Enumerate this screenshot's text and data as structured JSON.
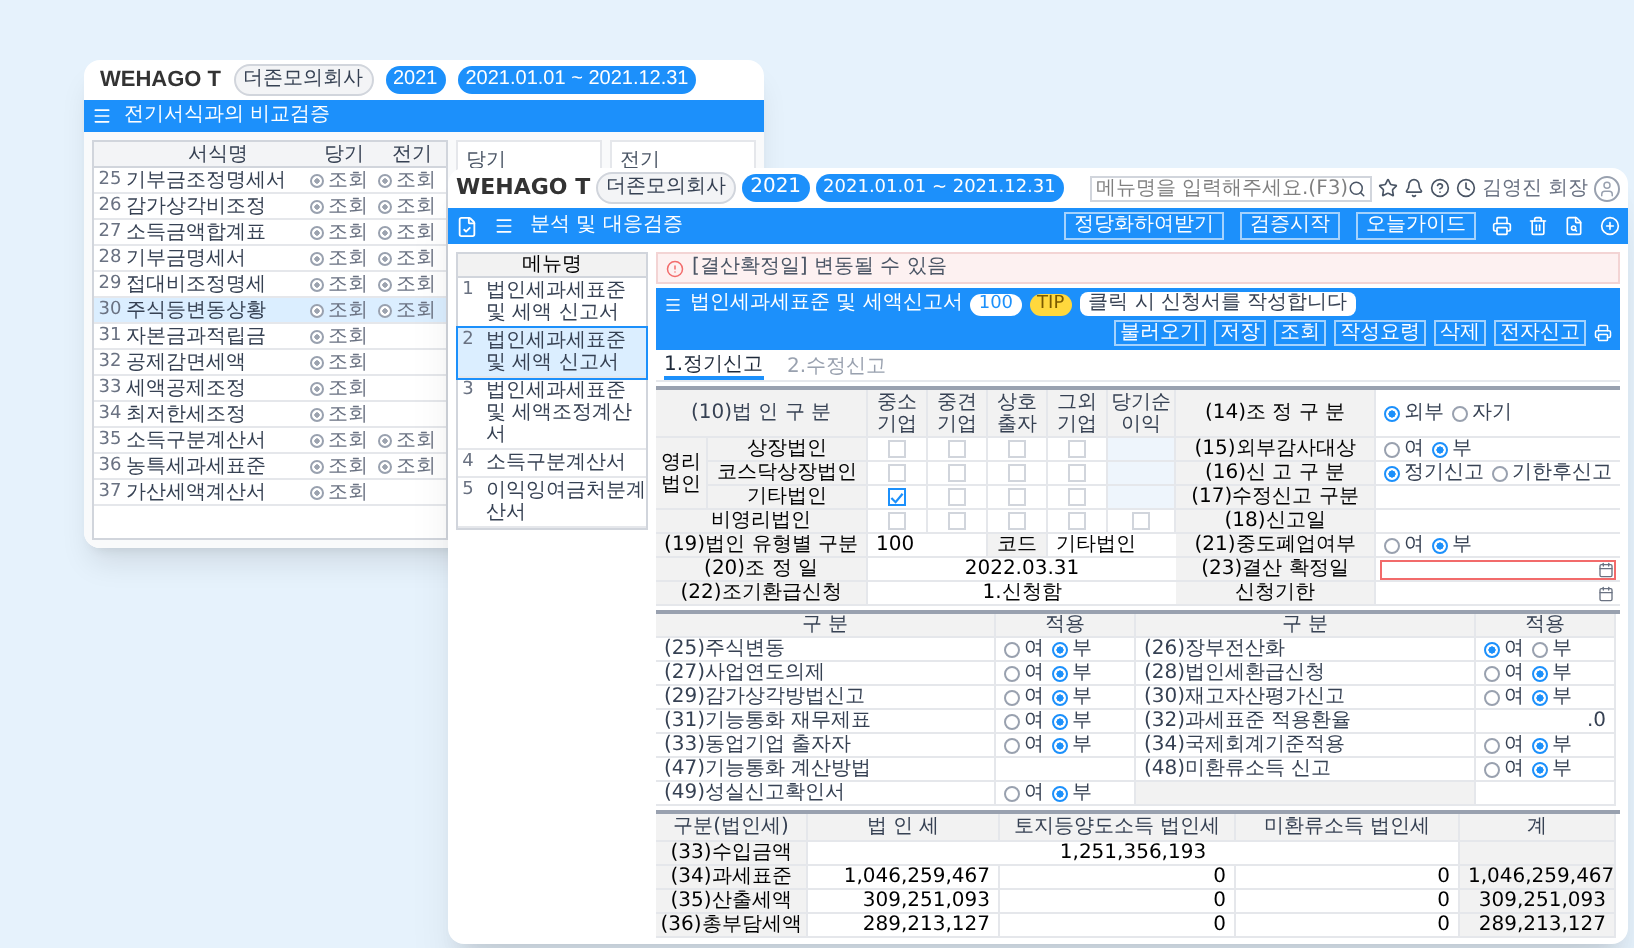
{
  "back_window": {
    "header": {
      "logo": "WEHAGO T",
      "company": "더존모의회사",
      "year": "2021",
      "period": "2021.01.01 ~ 2021.12.31"
    },
    "title": "전기서식과의 비교검증",
    "table": {
      "columns": [
        "서식명",
        "당기",
        "전기"
      ],
      "rows": [
        {
          "no": "25",
          "name": "기부금조정명세서",
          "current": "조회",
          "previous": "조회",
          "selected": false
        },
        {
          "no": "26",
          "name": "감가상각비조정",
          "current": "조회",
          "previous": "조회",
          "selected": false
        },
        {
          "no": "27",
          "name": "소득금액합계표",
          "current": "조회",
          "previous": "조회",
          "selected": false
        },
        {
          "no": "28",
          "name": "기부금명세서",
          "current": "조회",
          "previous": "조회",
          "selected": false
        },
        {
          "no": "29",
          "name": "접대비조정명세",
          "current": "조회",
          "previous": "조회",
          "selected": false
        },
        {
          "no": "30",
          "name": "주식등변동상황",
          "current": "조회",
          "previous": "조회",
          "selected": true
        },
        {
          "no": "31",
          "name": "자본금과적립금",
          "current": "조회",
          "previous": "",
          "selected": false
        },
        {
          "no": "32",
          "name": "공제감면세액",
          "current": "조회",
          "previous": "",
          "selected": false
        },
        {
          "no": "33",
          "name": "세액공제조정",
          "current": "조회",
          "previous": "",
          "selected": false
        },
        {
          "no": "34",
          "name": "최저한세조정",
          "current": "조회",
          "previous": "",
          "selected": false
        },
        {
          "no": "35",
          "name": "소득구분계산서",
          "current": "조회",
          "previous": "조회",
          "selected": false
        },
        {
          "no": "36",
          "name": "농특세과세표준",
          "current": "조회",
          "previous": "조회",
          "selected": false
        },
        {
          "no": "37",
          "name": "가산세액계산서",
          "current": "조회",
          "previous": "",
          "selected": false
        }
      ]
    },
    "preview_labels": [
      "당기",
      "전기"
    ]
  },
  "front_window": {
    "header": {
      "logo": "WEHAGO T",
      "company": "더존모의회사",
      "year": "2021",
      "period": "2021.01.01 ~ 2021.12.31",
      "search": {
        "placeholder": "메뉴명을 입력해주세요.(F3)"
      },
      "user": "김영진 회장"
    },
    "title": "분석 및 대응검증",
    "title_actions": [
      "정당화하여받기",
      "검증시작",
      "오늘가이드"
    ],
    "menu": {
      "column": "메뉴명",
      "items": [
        {
          "no": "1",
          "label": "법인세과세표준 및 세액 신고서",
          "selected": false
        },
        {
          "no": "2",
          "label": "법인세과세표준 및 세액 신고서",
          "selected": true
        },
        {
          "no": "3",
          "label": "법인세과세표준 및 세액조정계산서",
          "selected": false
        },
        {
          "no": "4",
          "label": "소득구분계산서",
          "selected": false
        },
        {
          "no": "5",
          "label": "이익잉여금처분계산서",
          "selected": false
        }
      ]
    },
    "alert": "[결산확정일] 변동될 수 있음",
    "form_title": "법인세과세표준 및 세액신고서",
    "form_badge": "100",
    "tip": {
      "badge": "TIP",
      "text": "클릭 시 신청서를 작성합니다"
    },
    "form_actions": [
      "불러오기",
      "저장",
      "조회",
      "작성요령",
      "삭제",
      "전자신고"
    ],
    "tabs": [
      {
        "label": "1.정기신고",
        "selected": true
      },
      {
        "label": "2.수정신고",
        "selected": false
      }
    ],
    "corp": {
      "label": "(10)법 인 구 분",
      "columns": [
        "중소기업",
        "중견기업",
        "상호출자",
        "그외기업",
        "당기순이익"
      ],
      "group": "영리법인",
      "rows": [
        {
          "label": "상장법인",
          "checks": [
            {
              "checked": false
            },
            {
              "checked": false
            },
            {
              "checked": false
            },
            {
              "checked": false
            }
          ]
        },
        {
          "label": "코스닥상장법인",
          "checks": [
            {
              "checked": false
            },
            {
              "checked": false
            },
            {
              "checked": false
            },
            {
              "checked": false
            }
          ]
        },
        {
          "label": "기타법인",
          "checks": [
            {
              "checked": true
            },
            {
              "checked": false
            },
            {
              "checked": false
            },
            {
              "checked": false
            }
          ]
        }
      ],
      "nonprofit": {
        "label": "비영리법인",
        "checks": [
          {
            "checked": false
          },
          {
            "checked": false
          },
          {
            "checked": false
          },
          {
            "checked": false
          },
          {
            "checked": false
          }
        ]
      },
      "fields": [
        {
          "label": "(19)법인 유형별 구분",
          "value": "100",
          "code_label": "코드",
          "code_value": "기타법인"
        },
        {
          "label": "(20)조 정 일",
          "value": "2022.03.31"
        },
        {
          "label": "(22)조기환급신청",
          "value": "1.신청함"
        }
      ]
    },
    "right_fields": [
      {
        "label": "(14)조 정 구 분",
        "kind": "radio",
        "options": [
          {
            "label": "외부",
            "selected": true
          },
          {
            "label": "자기",
            "selected": false
          }
        ]
      },
      {
        "label": "(15)외부감사대상",
        "kind": "radio",
        "options": [
          {
            "label": "여",
            "selected": false
          },
          {
            "label": "부",
            "selected": true
          }
        ]
      },
      {
        "label": "(16)신 고 구 분",
        "kind": "radio",
        "options": [
          {
            "label": "정기신고",
            "selected": true
          },
          {
            "label": "기한후신고",
            "selected": false
          }
        ]
      },
      {
        "label": "(17)수정신고 구분",
        "kind": "empty"
      },
      {
        "label": "(18)신고일",
        "kind": "empty"
      },
      {
        "label": "(21)중도폐업여부",
        "kind": "radio",
        "options": [
          {
            "label": "여",
            "selected": false
          },
          {
            "label": "부",
            "selected": true
          }
        ]
      },
      {
        "label": "(23)결산 확정일",
        "kind": "date",
        "error": true
      },
      {
        "label": "신청기한",
        "kind": "date",
        "error": false
      }
    ],
    "apply": {
      "columns": [
        "구 분",
        "적용",
        "구 분",
        "적용"
      ],
      "rows": [
        {
          "left": {
            "label": "(25)주식변동",
            "kind": "radio",
            "options": [
              {
                "label": "여",
                "selected": false
              },
              {
                "label": "부",
                "selected": true
              }
            ]
          },
          "right": {
            "label": "(26)장부전산화",
            "kind": "radio",
            "options": [
              {
                "label": "여",
                "selected": true
              },
              {
                "label": "부",
                "selected": false
              }
            ]
          }
        },
        {
          "left": {
            "label": "(27)사업연도의제",
            "kind": "radio",
            "options": [
              {
                "label": "여",
                "selected": false
              },
              {
                "label": "부",
                "selected": true
              }
            ]
          },
          "right": {
            "label": "(28)법인세환급신청",
            "kind": "radio",
            "options": [
              {
                "label": "여",
                "selected": false
              },
              {
                "label": "부",
                "selected": true
              }
            ]
          }
        },
        {
          "left": {
            "label": "(29)감가상각방법신고",
            "kind": "radio",
            "options": [
              {
                "label": "여",
                "selected": false
              },
              {
                "label": "부",
                "selected": true
              }
            ]
          },
          "right": {
            "label": "(30)재고자산평가신고",
            "kind": "radio",
            "options": [
              {
                "label": "여",
                "selected": false
              },
              {
                "label": "부",
                "selected": true
              }
            ]
          }
        },
        {
          "left": {
            "label": "(31)기능통화 재무제표",
            "kind": "radio",
            "options": [
              {
                "label": "여",
                "selected": false
              },
              {
                "label": "부",
                "selected": true
              }
            ]
          },
          "right": {
            "label": "(32)과세표준 적용환율",
            "kind": "text",
            "value": ".0"
          }
        },
        {
          "left": {
            "label": "(33)동업기업 출자자",
            "kind": "radio",
            "options": [
              {
                "label": "여",
                "selected": false
              },
              {
                "label": "부",
                "selected": true
              }
            ]
          },
          "right": {
            "label": "(34)국제회계기준적용",
            "kind": "radio",
            "options": [
              {
                "label": "여",
                "selected": false
              },
              {
                "label": "부",
                "selected": true
              }
            ]
          }
        },
        {
          "left": {
            "label": "(47)기능통화 계산방법",
            "kind": "empty"
          },
          "right": {
            "label": "(48)미환류소득 신고",
            "kind": "radio",
            "options": [
              {
                "label": "여",
                "selected": false
              },
              {
                "label": "부",
                "selected": true
              }
            ]
          }
        },
        {
          "left": {
            "label": "(49)성실신고확인서",
            "kind": "radio",
            "options": [
              {
                "label": "여",
                "selected": false
              },
              {
                "label": "부",
                "selected": true
              }
            ]
          },
          "right": {
            "kind": "empty"
          }
        }
      ]
    },
    "tax": {
      "columns": [
        "구분(법인세)",
        "법 인 세",
        "토지등양도소득 법인세",
        "미환류소득 법인세",
        "계"
      ],
      "rows": [
        {
          "label": "(33)수입금액",
          "span": "1,251,356,193"
        },
        {
          "label": "(34)과세표준",
          "cells": [
            "1,046,259,467",
            "0",
            "0",
            "1,046,259,467"
          ]
        },
        {
          "label": "(35)산출세액",
          "cells": [
            "309,251,093",
            "0",
            "0",
            "309,251,093"
          ]
        },
        {
          "label": "(36)총부담세액",
          "cells": [
            "289,213,127",
            "0",
            "0",
            "289,213,127"
          ]
        }
      ]
    }
  }
}
